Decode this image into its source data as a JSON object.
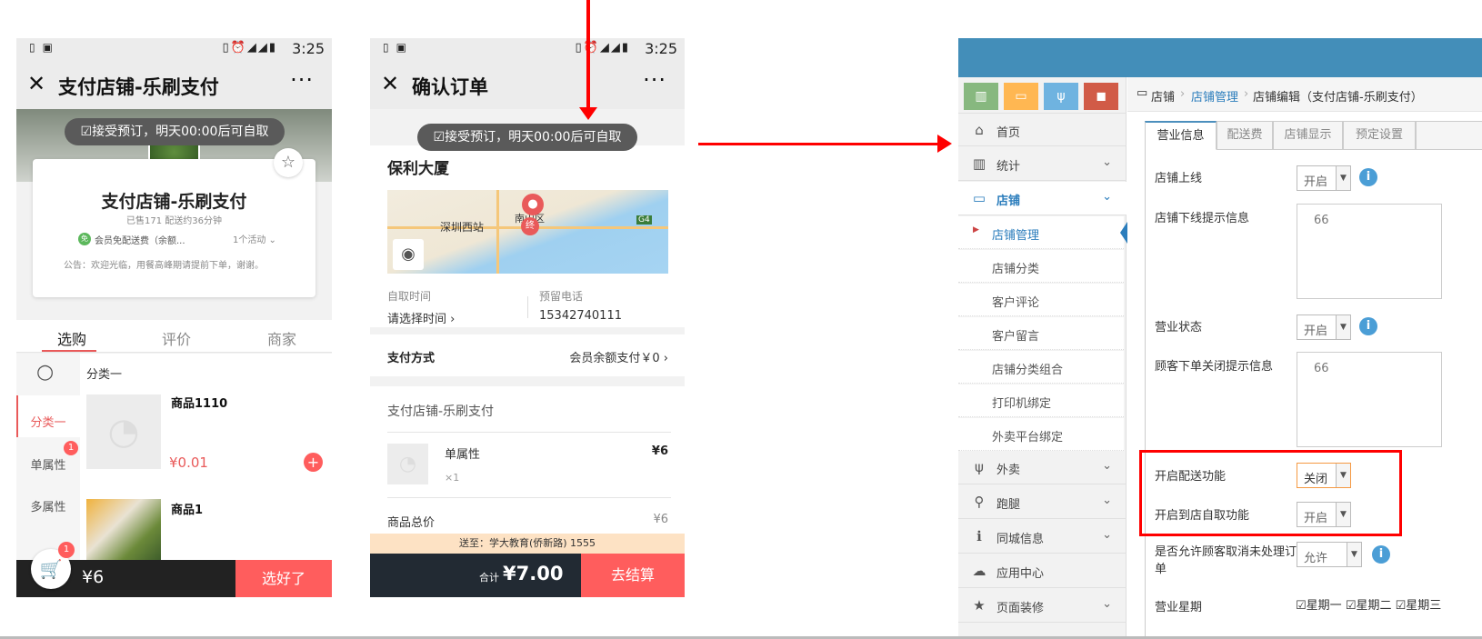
{
  "status_bar": {
    "time": "3:25"
  },
  "phone1": {
    "title": "支付店铺-乐刷支付",
    "notice_pill": "接受预订，明天00:00后可自取",
    "shop_name": "支付店铺-乐刷支付",
    "shop_meta": "已售171 配送约36分钟",
    "promo": "会员免配送费（余额...",
    "promo_count": "1个活动",
    "announcement": "公告：欢迎光临，用餐高峰期请提前下单，谢谢。",
    "tabs": [
      "选购",
      "评价",
      "商家"
    ],
    "categories": [
      {
        "label": "分类一",
        "badge": ""
      },
      {
        "label": "单属性",
        "badge": "1"
      },
      {
        "label": "多属性",
        "badge": ""
      }
    ],
    "section_title": "分类一",
    "products": [
      {
        "name": "商品1110",
        "price": "¥0.01"
      },
      {
        "name": "商品1",
        "price": ""
      }
    ],
    "cart_badge": "1",
    "total": "¥6",
    "checkout_label": "选好了"
  },
  "phone2": {
    "title": "确认订单",
    "notice_pill": "接受预订，明天00:00后可自取",
    "address": "保利大厦",
    "map_labels": {
      "station": "深圳西站",
      "district": "南山区",
      "end_marker": "终",
      "road": "G4"
    },
    "pickup_time_label": "自取时间",
    "pickup_time_value": "请选择时间",
    "phone_label": "预留电话",
    "phone_value": "15342740111",
    "payment_label": "支付方式",
    "payment_value": "会员余额支付￥0",
    "shop_name": "支付店铺-乐刷支付",
    "item_name": "单属性",
    "item_qty": "×1",
    "item_price": "¥6",
    "subtotal_label": "商品总价",
    "subtotal_value": "¥6",
    "delivery_to": "送至：学大教育(侨新路) 1555",
    "total_label": "合计",
    "total_value": "¥7.00",
    "checkout_label": "去结算"
  },
  "admin": {
    "breadcrumb": [
      "店铺",
      "店铺管理",
      "店铺编辑（支付店铺-乐刷支付）"
    ],
    "nav": [
      {
        "label": "首页",
        "icon": "home-icon"
      },
      {
        "label": "统计",
        "icon": "bar-chart-icon"
      },
      {
        "label": "店铺",
        "icon": "monitor-icon"
      },
      {
        "label": "外卖",
        "icon": "cutlery-icon"
      },
      {
        "label": "跑腿",
        "icon": "bicycle-icon"
      },
      {
        "label": "同城信息",
        "icon": "info-icon"
      },
      {
        "label": "应用中心",
        "icon": "cloud-icon"
      },
      {
        "label": "页面装修",
        "icon": "star-icon"
      }
    ],
    "subnav": [
      "店铺管理",
      "店铺分类",
      "客户评论",
      "客户留言",
      "店铺分类组合",
      "打印机绑定",
      "外卖平台绑定"
    ],
    "tabs": [
      "营业信息",
      "配送费",
      "店铺显示",
      "预定设置"
    ],
    "fields": {
      "shop_online_label": "店铺上线",
      "shop_online_value": "开启",
      "offline_tip_label": "店铺下线提示信息",
      "offline_tip_value": "66",
      "business_status_label": "营业状态",
      "business_status_value": "开启",
      "order_closed_tip_label": "顾客下单关闭提示信息",
      "order_closed_tip_value": "66",
      "delivery_label": "开启配送功能",
      "delivery_value": "关闭",
      "pickup_label": "开启到店自取功能",
      "pickup_value": "开启",
      "cancel_label": "是否允许顾客取消未处理订单",
      "cancel_value": "允许",
      "weekday_label": "营业星期",
      "weekdays": [
        "星期一",
        "星期二",
        "星期三"
      ]
    }
  },
  "colors": {
    "accent_red": "#ff5d5d",
    "admin_blue": "#438eb9",
    "arrow_red": "#ff0000"
  }
}
